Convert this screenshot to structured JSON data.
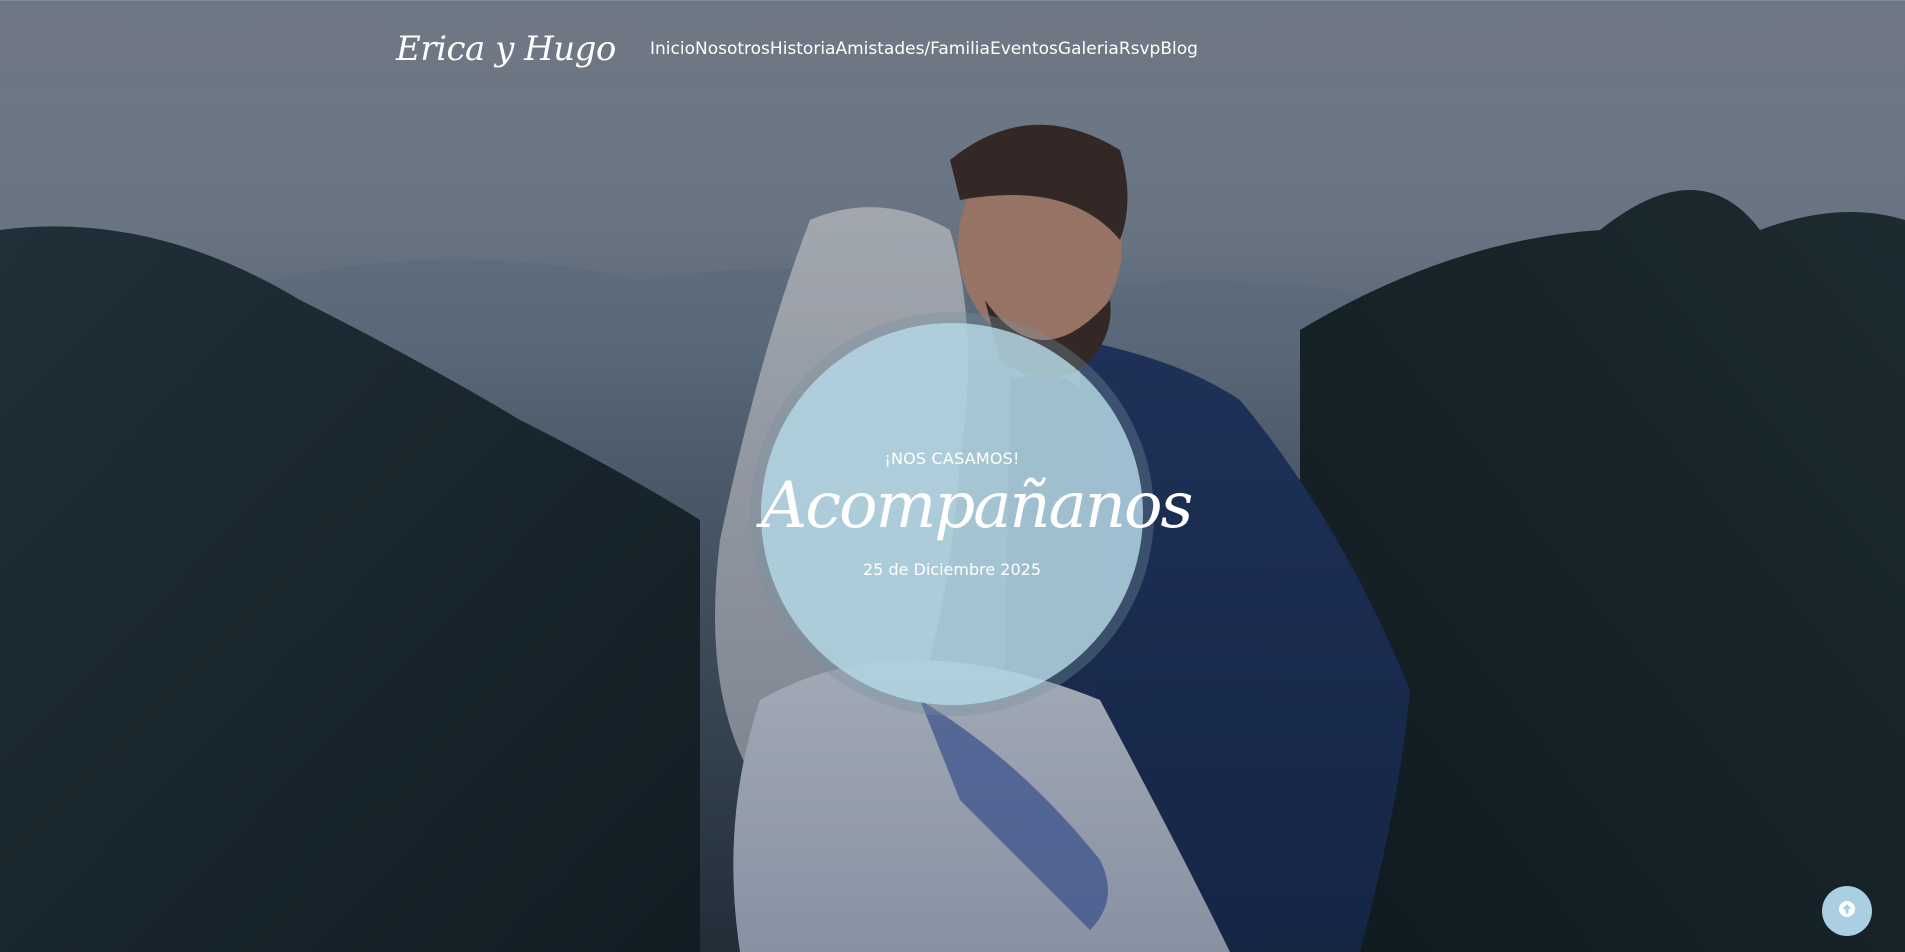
{
  "brand": {
    "name": "Erica y Hugo"
  },
  "nav": {
    "items": [
      {
        "label": "Inicio"
      },
      {
        "label": "Nosotros"
      },
      {
        "label": "Historia"
      },
      {
        "label": "Amistades/Familia"
      },
      {
        "label": "Eventos"
      },
      {
        "label": "Galeria"
      },
      {
        "label": "Rsvp"
      },
      {
        "label": "Blog"
      }
    ]
  },
  "hero": {
    "kicker": "¡NOS CASAMOS!",
    "title": "Acompañanos",
    "date": "25 de Diciembre 2025",
    "circle_color": "#b2d4e1"
  },
  "scroll_top": {
    "icon": "arrow-up-icon",
    "color": "#a9cfe0"
  }
}
